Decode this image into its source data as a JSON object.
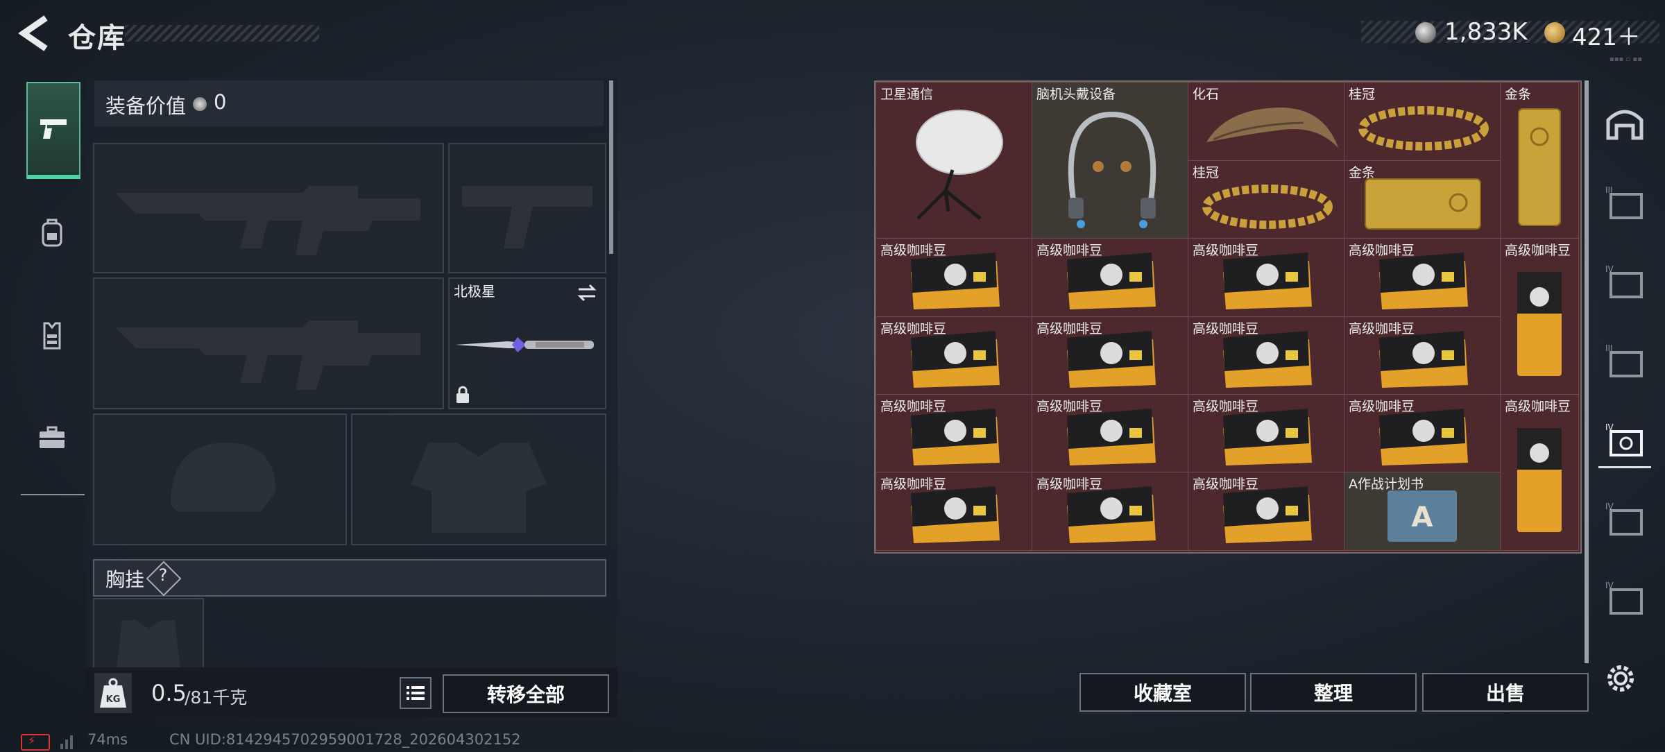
{
  "header": {
    "title": "仓库",
    "currency_silver": "1,833K",
    "currency_gold": "421＋"
  },
  "left_nav": {
    "items": [
      {
        "name": "weapons",
        "icon": "pistol-icon",
        "active": true
      },
      {
        "name": "backpack",
        "icon": "backpack-icon"
      },
      {
        "name": "vest",
        "icon": "vest-icon"
      },
      {
        "name": "case",
        "icon": "briefcase-icon"
      }
    ]
  },
  "equipment": {
    "value_label": "装备价值",
    "value": "0",
    "melee_label": "北极星",
    "chest_label": "胸挂",
    "chest_help": "?"
  },
  "weight": {
    "current": "0.5",
    "max": "/81千克"
  },
  "actions": {
    "transfer_all": "转移全部",
    "stash_room": "收藏室",
    "organize": "整理",
    "sell": "出售"
  },
  "status": {
    "ping": "74ms",
    "uid": "CN UID:8142945702959001728_202604302152"
  },
  "storage_items": {
    "satellite": "卫星通信",
    "headset": "脑机头戴设备",
    "fossil": "化石",
    "laurel": "桂冠",
    "gold_bar": "金条",
    "coffee": "高级咖啡豆",
    "battle_plan": "A作战计划书"
  },
  "colors": {
    "accent": "#4fd3a3",
    "grid_bg": "#4d282d",
    "grid_border": "#6e4c52"
  }
}
